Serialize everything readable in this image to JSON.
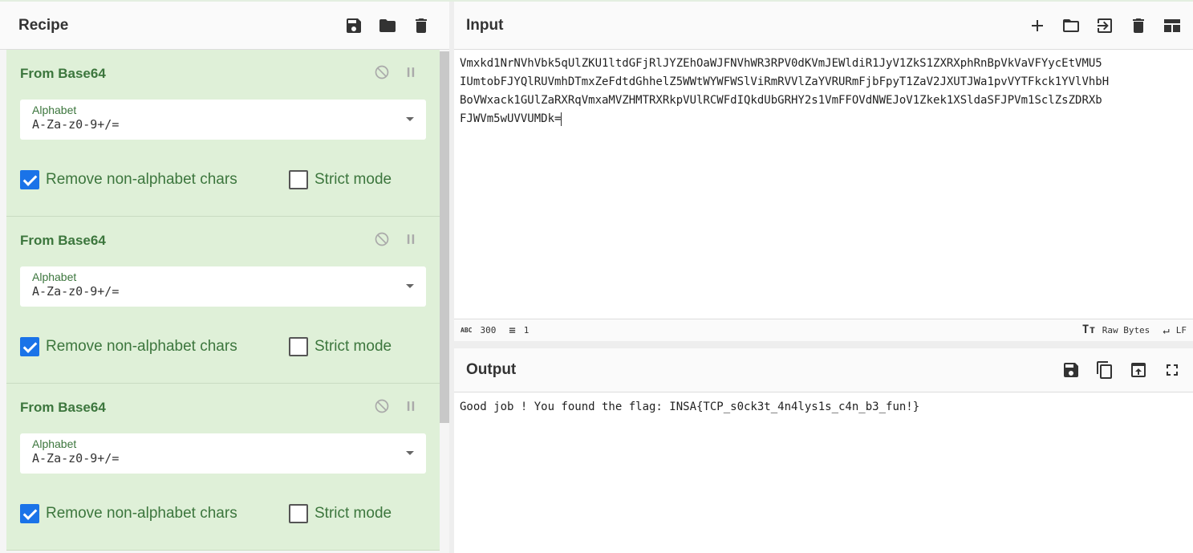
{
  "recipe": {
    "title": "Recipe",
    "icons": [
      "save-icon",
      "folder-icon",
      "trash-icon"
    ],
    "operations": [
      {
        "name": "From Base64",
        "alphabet_label": "Alphabet",
        "alphabet": "A-Za-z0-9+/=",
        "remove_label": "Remove non-alphabet chars",
        "remove": true,
        "strict_label": "Strict mode",
        "strict": false
      },
      {
        "name": "From Base64",
        "alphabet_label": "Alphabet",
        "alphabet": "A-Za-z0-9+/=",
        "remove_label": "Remove non-alphabet chars",
        "remove": true,
        "strict_label": "Strict mode",
        "strict": false
      },
      {
        "name": "From Base64",
        "alphabet_label": "Alphabet",
        "alphabet": "A-Za-z0-9+/=",
        "remove_label": "Remove non-alphabet chars",
        "remove": true,
        "strict_label": "Strict mode",
        "strict": false
      }
    ]
  },
  "input": {
    "title": "Input",
    "lines": [
      "Vmxkd1NrNVhVbk5qUlZKU1ltdGFjRlJYZEhOaWJFNVhWR3RPV0dKVmJEWldiR1JyV1ZkS1ZXRXphRnBpVkVaVFYycEtVMU5",
      "IUmtobFJYQlRUVmhDTmxZeFdtdGhhelZ5WWtWYWFWSlViRmRVVlZaYVRURmFjbFpyT1ZaV2JXUTJWa1pvVYTFkck1YVlVhbH",
      "BoVWxack1GUlZaRXRqVmxaMVZHMTRXRkpVUlRCWFdIQkdUbGRHY2s1VmFFOVdNWEJoV1Zkek1XSldaSFJPVm1SclZsZDRXb",
      "FJWVm5wUVVUMDk="
    ],
    "chars": "300",
    "lines_count": "1",
    "format": "Raw Bytes",
    "eol": "LF"
  },
  "output": {
    "title": "Output",
    "text": "Good job ! You found the flag: INSA{TCP_s0ck3t_4n4lys1s_c4n_b3_fun!}"
  }
}
